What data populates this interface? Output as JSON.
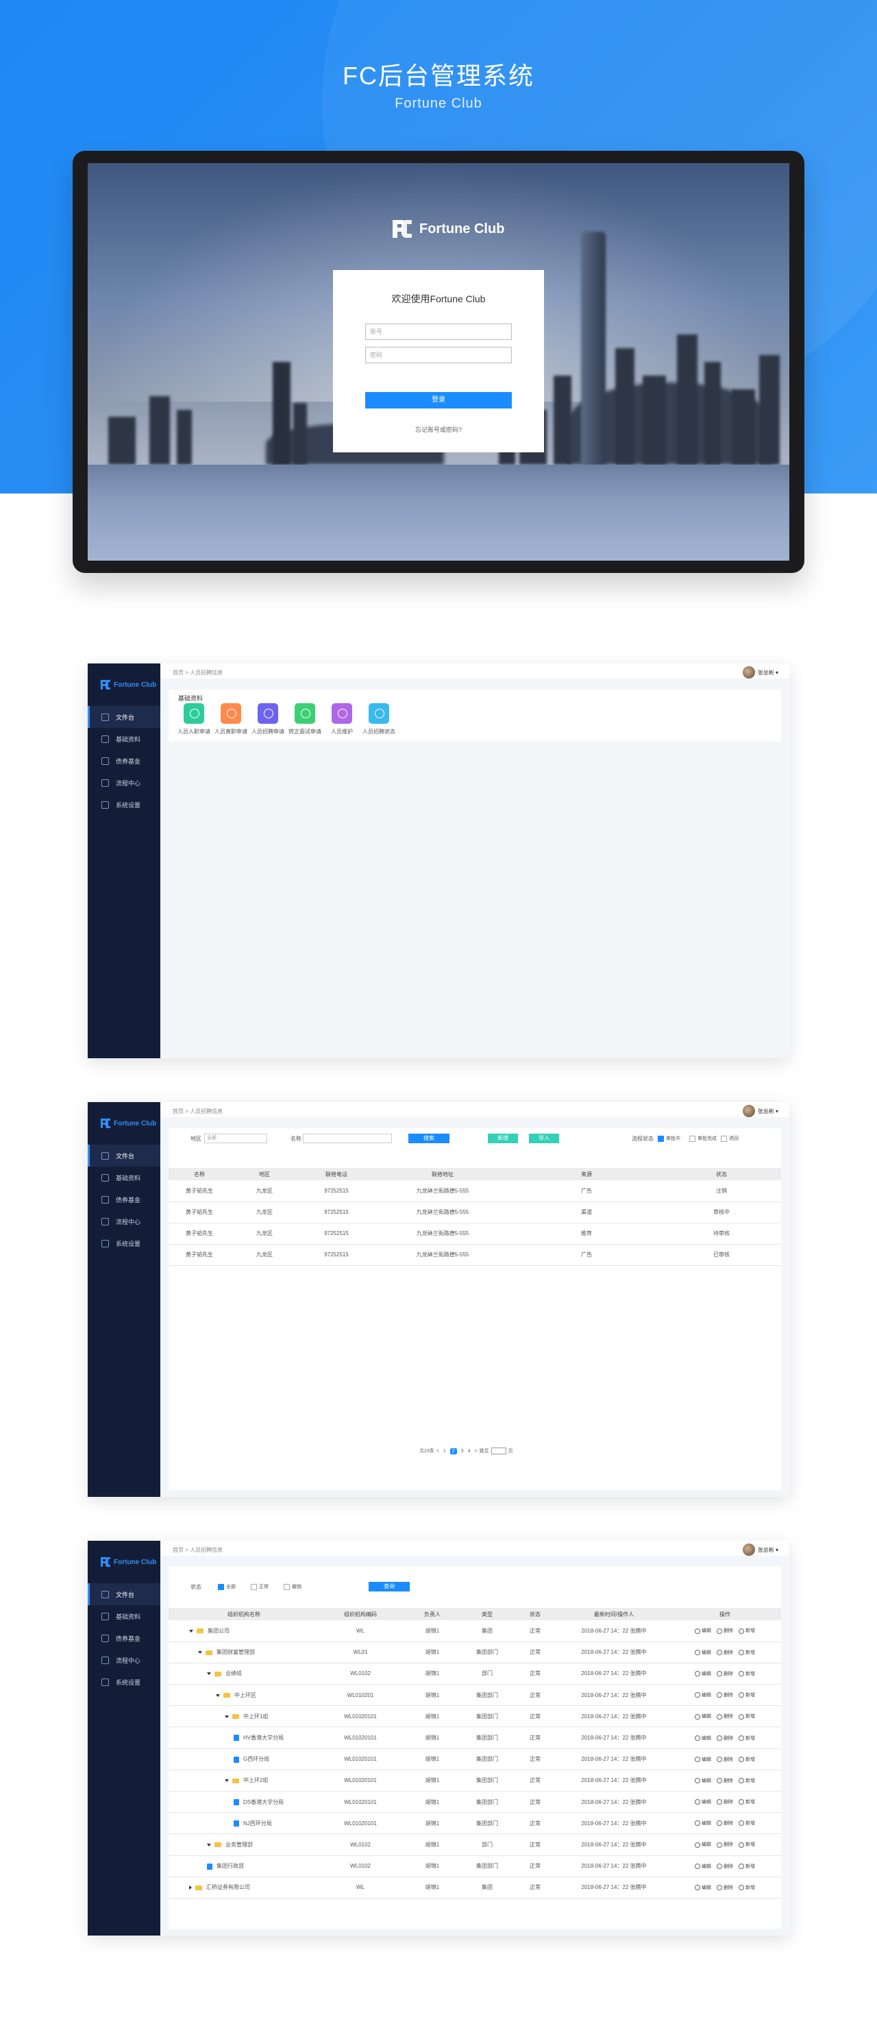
{
  "hero": {
    "title": "FC后台管理系统",
    "subtitle": "Fortune Club"
  },
  "login": {
    "brand": "Fortune Club",
    "welcome": "欢迎使用Fortune Club",
    "account_placeholder": "账号",
    "password_placeholder": "密码",
    "submit": "登录",
    "forgot": "忘记账号或密码?"
  },
  "app": {
    "brand": "Fortune Club",
    "user": "张总彬",
    "sidebar": [
      "文件台",
      "基础资料",
      "债券基金",
      "流程中心",
      "系统设置"
    ],
    "breadcrumb": "首页 > 人员招聘信息"
  },
  "screen1": {
    "section_title": "基础资料",
    "quick_items": [
      {
        "label": "人员入职申请",
        "color": "#2ecc9a"
      },
      {
        "label": "人员离职申请",
        "color": "#ff8a4c"
      },
      {
        "label": "人员招聘申请",
        "color": "#6c63f0"
      },
      {
        "label": "转正面试申请",
        "color": "#3ccf74"
      },
      {
        "label": "人员维护",
        "color": "#b066e8"
      },
      {
        "label": "人员招聘状态",
        "color": "#3ab8f0"
      }
    ]
  },
  "screen2": {
    "filters": {
      "region_label": "地区",
      "region_value": "全部",
      "name_label": "名称",
      "search_btn": "搜索",
      "add_btn": "新增",
      "import_btn": "导入",
      "status_label": "流程状态",
      "status_options": [
        {
          "label": "审批中",
          "checked": true
        },
        {
          "label": "审批完成",
          "checked": false
        },
        {
          "label": "退回",
          "checked": false
        }
      ]
    },
    "columns": [
      "名称",
      "地区",
      "联络电话",
      "联络地址",
      "来源",
      "状态"
    ],
    "rows": [
      [
        "黄子韬先生",
        "九龙区",
        "97252515",
        "九龙砵兰街路德5-555",
        "广告",
        "注销"
      ],
      [
        "黄子韬先生",
        "九龙区",
        "97252515",
        "九龙砵兰街路德5-555",
        "渠道",
        "审核中"
      ],
      [
        "黄子韬先生",
        "九龙区",
        "97252515",
        "九龙砵兰街路德5-555",
        "推荐",
        "待审核"
      ],
      [
        "黄子韬先生",
        "九龙区",
        "97252515",
        "九龙砵兰街路德5-555",
        "广告",
        "已审核"
      ]
    ],
    "pager": {
      "total": "共23条",
      "prev": "<",
      "pages": [
        "1",
        "2",
        "3",
        "4"
      ],
      "next": ">",
      "goto": "跳至",
      "page_unit": "页"
    }
  },
  "screen3": {
    "filters": {
      "status_label": "状态",
      "options": [
        {
          "label": "全部",
          "checked": true
        },
        {
          "label": "正常",
          "checked": false
        },
        {
          "label": "撤销",
          "checked": false
        }
      ],
      "search_btn": "查询"
    },
    "columns": [
      "组织机构名称",
      "组织机构编码",
      "负责人",
      "类型",
      "状态",
      "最新时间/操作人",
      "操作"
    ],
    "ops": [
      "编辑",
      "删除",
      "新增"
    ],
    "rows": [
      {
        "name": "集团公司",
        "level": 0,
        "kind": "folder",
        "open": true,
        "code": "WL",
        "owner": "胡锦1",
        "type": "集团",
        "status": "正常",
        "time": "2018-06-27 14：22 张腾中"
      },
      {
        "name": "集团财富管理部",
        "level": 1,
        "kind": "folder",
        "open": true,
        "code": "WL01",
        "owner": "胡锦1",
        "type": "集团部门",
        "status": "正常",
        "time": "2018-06-27 14：22 张腾中"
      },
      {
        "name": "业绩组",
        "level": 2,
        "kind": "folder",
        "open": true,
        "code": "WL0102",
        "owner": "胡锦1",
        "type": "部门",
        "status": "正常",
        "time": "2018-06-27 14：22 张腾中"
      },
      {
        "name": "中上环区",
        "level": 3,
        "kind": "folder",
        "open": true,
        "code": "WL010201",
        "owner": "胡锦1",
        "type": "集团部门",
        "status": "正常",
        "time": "2018-06-27 14：22 张腾中"
      },
      {
        "name": "中上环1组",
        "level": 4,
        "kind": "folder",
        "open": true,
        "code": "WL01020101",
        "owner": "胡锦1",
        "type": "集团部门",
        "status": "正常",
        "time": "2018-06-27 14：22 张腾中"
      },
      {
        "name": "HV香港大学分局",
        "level": 5,
        "kind": "doc",
        "code": "WL01020101",
        "owner": "胡锦1",
        "type": "集团部门",
        "status": "正常",
        "time": "2018-06-27 14：22 张腾中"
      },
      {
        "name": "G西环分局",
        "level": 5,
        "kind": "doc",
        "code": "WL01020101",
        "owner": "胡锦1",
        "type": "集团部门",
        "status": "正常",
        "time": "2018-06-27 14：22 张腾中"
      },
      {
        "name": "中上环2组",
        "level": 4,
        "kind": "folder",
        "open": true,
        "code": "WL01020101",
        "owner": "胡锦1",
        "type": "集团部门",
        "status": "正常",
        "time": "2018-06-27 14：22 张腾中"
      },
      {
        "name": "DS香港大学分局",
        "level": 5,
        "kind": "doc",
        "code": "WL01020101",
        "owner": "胡锦1",
        "type": "集团部门",
        "status": "正常",
        "time": "2018-06-27 14：22 张腾中"
      },
      {
        "name": "NJ西环分局",
        "level": 5,
        "kind": "doc",
        "code": "WL01020101",
        "owner": "胡锦1",
        "type": "集团部门",
        "status": "正常",
        "time": "2018-06-27 14：22 张腾中"
      },
      {
        "name": "业务管理部",
        "level": 2,
        "kind": "folder",
        "open": true,
        "code": "WL0102",
        "owner": "胡锦1",
        "type": "部门",
        "status": "正常",
        "time": "2018-06-27 14：22 张腾中"
      },
      {
        "name": "集团行政部",
        "level": 2,
        "kind": "doc",
        "code": "WL0102",
        "owner": "胡锦1",
        "type": "集团部门",
        "status": "正常",
        "time": "2018-06-27 14：22 张腾中"
      },
      {
        "name": "汇桥证券有限公司",
        "level": 0,
        "kind": "folder",
        "open": false,
        "code": "WL",
        "owner": "胡锦1",
        "type": "集团",
        "status": "正常",
        "time": "2018-06-27 14：22 张腾中"
      }
    ]
  }
}
